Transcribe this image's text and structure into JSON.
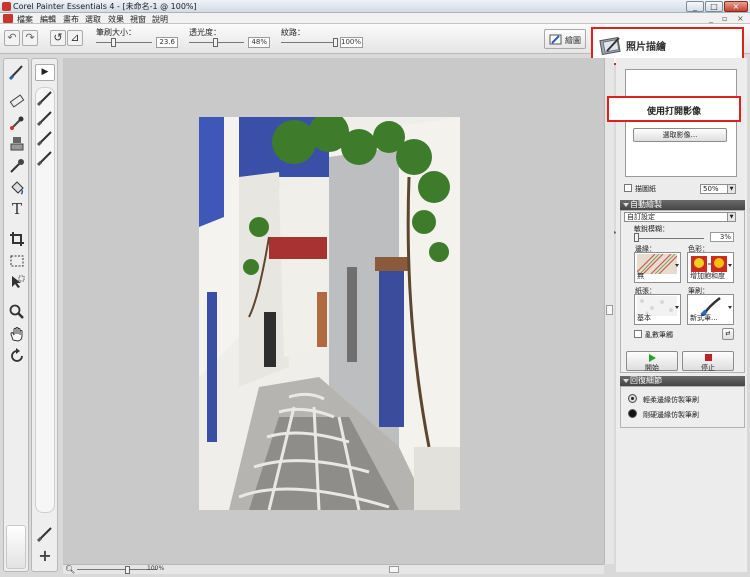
{
  "window": {
    "title": "Corel Painter Essentials 4 - [未命名-1 @ 100%]",
    "buttons": [
      "_",
      "□",
      "×"
    ]
  },
  "menu": {
    "items": [
      "檔案",
      "編輯",
      "畫布",
      "選取",
      "效果",
      "視窗",
      "說明"
    ],
    "window_controls": [
      "_",
      "▫",
      "×"
    ]
  },
  "propbar": {
    "brush_size_label": "筆刷大小：",
    "brush_size_value": "23.6",
    "brush_size_fraction": 0.3,
    "opacity_label": "透光度：",
    "opacity_value": "48%",
    "opacity_fraction": 0.48,
    "grain_label": "紋路：",
    "grain_value": "100%",
    "grain_fraction": 1.0
  },
  "mode_tabs": {
    "paint": "繪圖",
    "photo": "照片描繪"
  },
  "canvas": {
    "zoom": "100%"
  },
  "right_panel": {
    "open_image_button": "使用打開影像",
    "select_image_button": "選取影像...",
    "tracing_paper_label": "描圖紙",
    "tracing_paper_value": "50%",
    "auto_paint": {
      "header": "自動繪製",
      "preset": "自訂設定",
      "sensitivity_label": "敏銳模糊：",
      "sensitivity_value": "3%",
      "sensitivity_fraction": 0.03,
      "smoothing_label": "邊緣：",
      "smoothing_value": "無",
      "color_label": "色彩：",
      "color_value": "增加飽和度",
      "paper_label": "紙張：",
      "paper_value": "基本",
      "brush_label": "筆刷：",
      "brush_value": "新式筆...",
      "random_brush_label": "亂數筆觸",
      "start_button": "開始",
      "stop_button": "停止"
    },
    "restore_detail": {
      "header": "回復細節",
      "soft_edge_label": "輕柔邊緣仿製筆刷",
      "hard_edge_label": "剛硬邊緣仿製筆刷"
    }
  },
  "colors": {
    "highlight": "#e0211a",
    "panel_header": "#555555",
    "start_icon": "#2aa02a",
    "stop_icon": "#c0202a"
  }
}
